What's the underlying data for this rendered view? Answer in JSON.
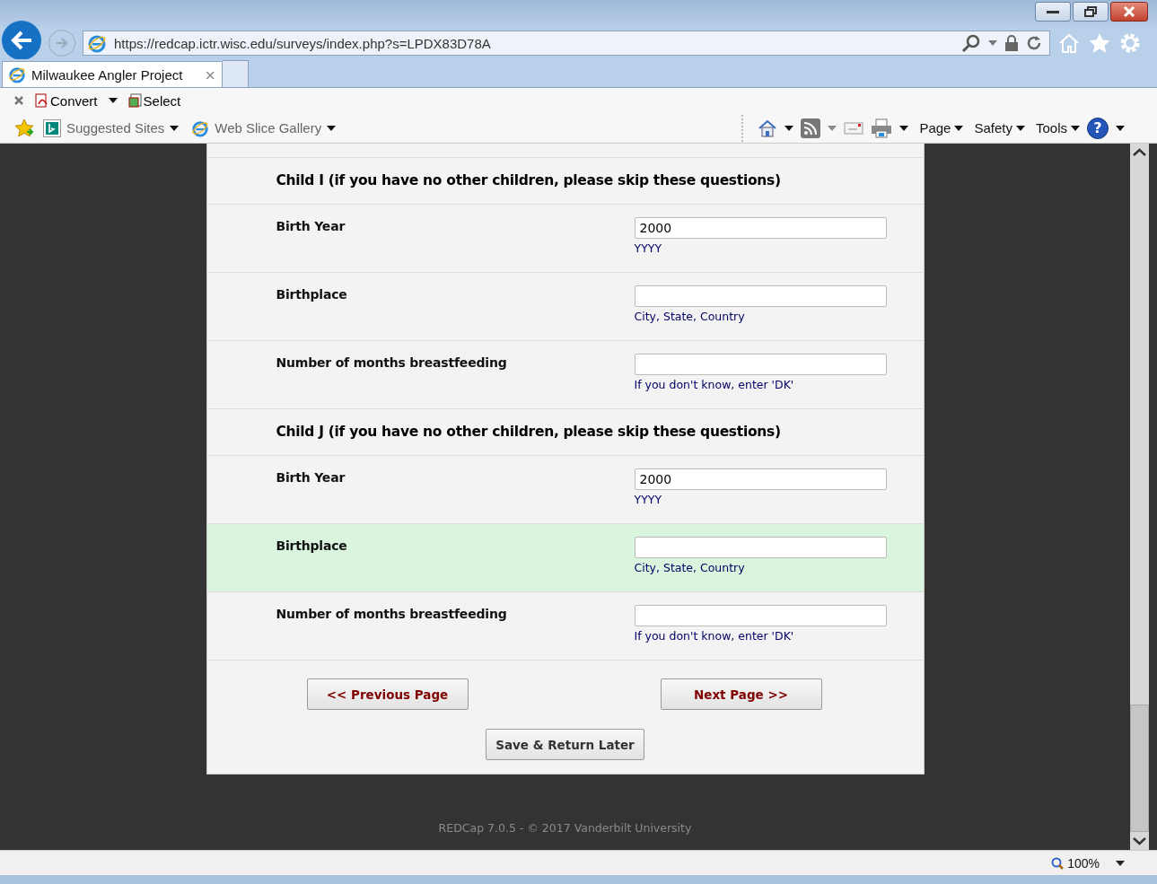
{
  "browser": {
    "url": "https://redcap.ictr.wisc.edu/surveys/index.php?s=LPDX83D78A",
    "tabs": [
      {
        "label": "Milwaukee Angler Project",
        "close": "×",
        "selected": true
      }
    ],
    "command_bar": [
      {
        "label": "Convert",
        "dropdown": true
      },
      {
        "label": "Select",
        "dropdown": false
      }
    ],
    "favorites": [
      {
        "label": "Suggested Sites"
      },
      {
        "label": "Web Slice Gallery"
      }
    ],
    "menus": [
      "Page",
      "Safety",
      "Tools"
    ],
    "help": "?",
    "zoom": "100%"
  },
  "form": {
    "rows": [
      {
        "kind": "header",
        "text": "Child I (if you have no other children, please skip these questions)"
      },
      {
        "kind": "field",
        "label": "Birth Year",
        "value": "2000",
        "note": "YYYY",
        "highlighted": false
      },
      {
        "kind": "field",
        "label": "Birthplace",
        "value": "",
        "note": "City, State, Country",
        "highlighted": false
      },
      {
        "kind": "field",
        "label": "Number of months breastfeeding",
        "value": "",
        "note": "If you don't know, enter 'DK'",
        "highlighted": false
      },
      {
        "kind": "header",
        "text": "Child J (if you have no other children, please skip these questions)"
      },
      {
        "kind": "field",
        "label": "Birth Year",
        "value": "2000",
        "note": "YYYY",
        "highlighted": false
      },
      {
        "kind": "field",
        "label": "Birthplace",
        "value": "",
        "note": "City, State, Country",
        "highlighted": true
      },
      {
        "kind": "field",
        "label": "Number of months breastfeeding",
        "value": "",
        "note": "If you don't know, enter 'DK'",
        "highlighted": false
      }
    ],
    "previous": "<< Previous Page",
    "next": "Next Page >>",
    "save": "Save & Return Later"
  },
  "footer": "REDCap 7.0.5 - © 2017 Vanderbilt University"
}
